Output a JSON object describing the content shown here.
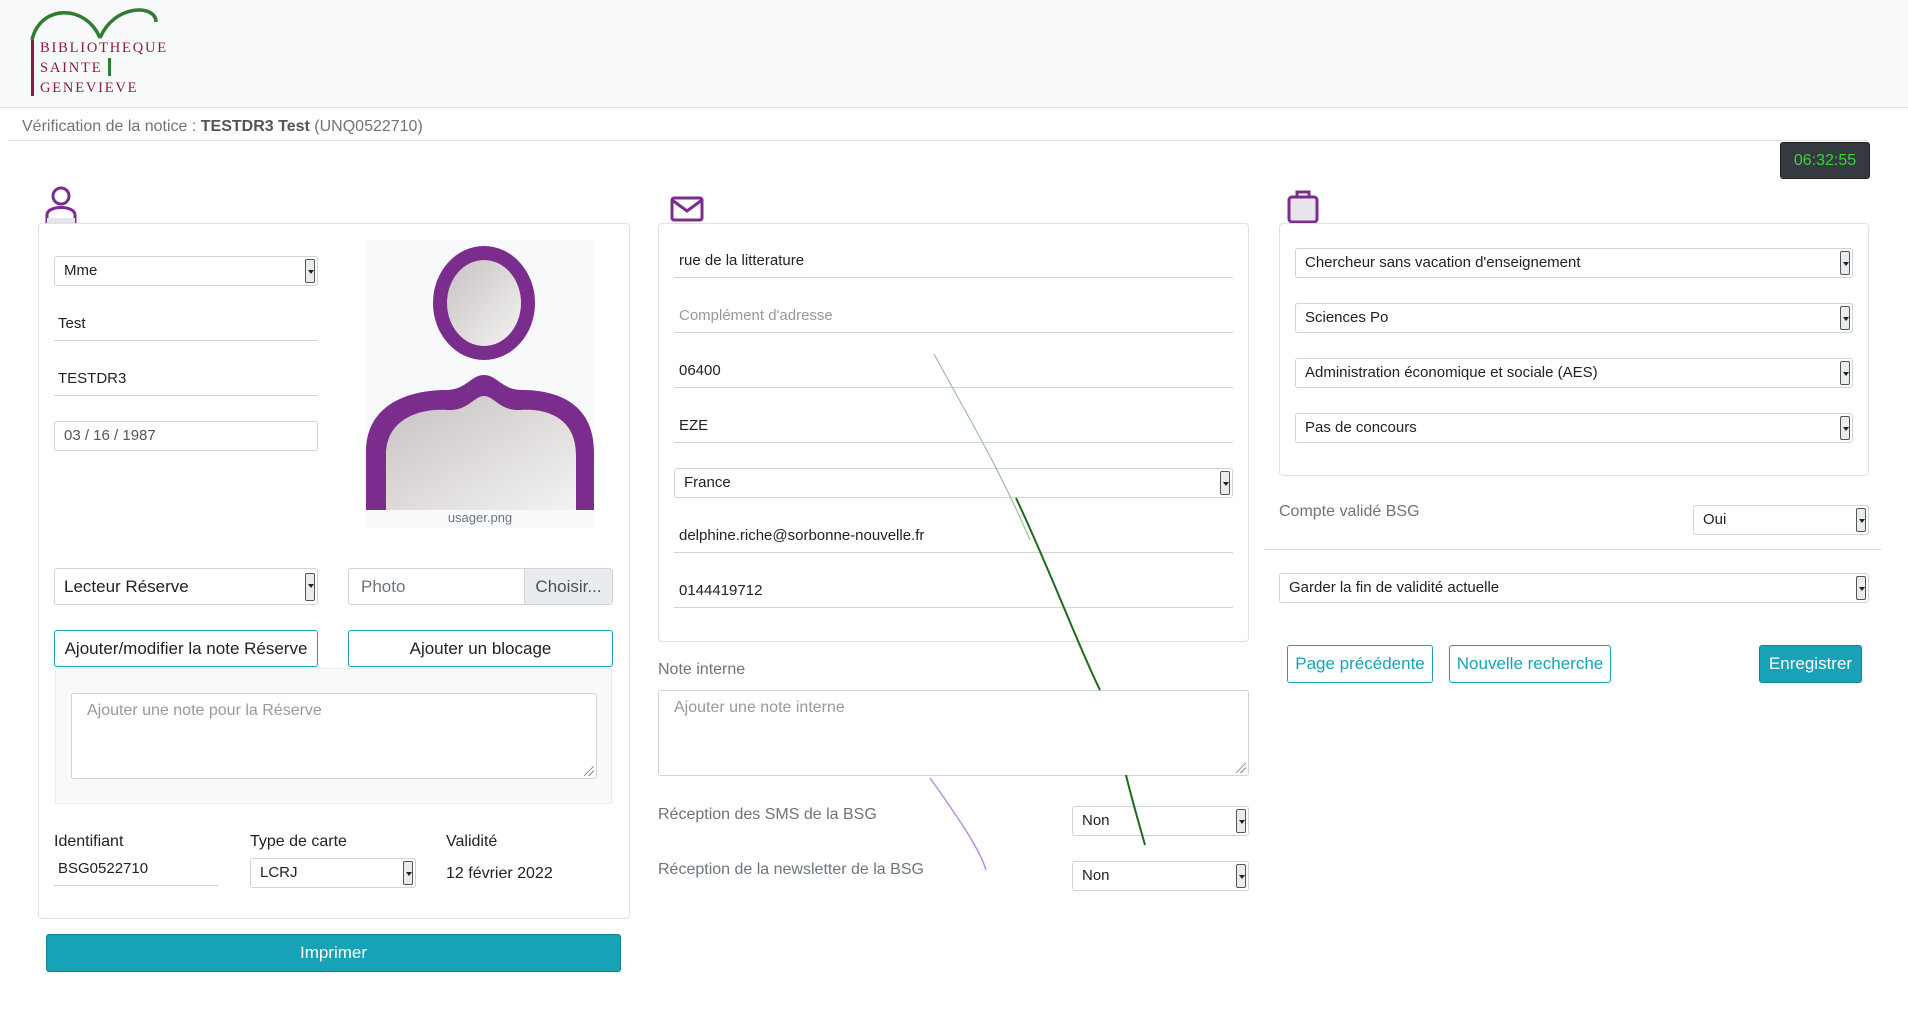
{
  "header": {
    "logo_text": [
      "BIBLIOTHEQUE",
      "SAINTE",
      "GENEVIEVE"
    ]
  },
  "notice": {
    "prefix": "Vérification de la notice : ",
    "name": "TESTDR3 Test",
    "id": "(UNQ0522710)"
  },
  "timer": "06:32:55",
  "personal": {
    "civility": "Mme",
    "first_name": "Test",
    "last_name": "TESTDR3",
    "birth_date": "03 / 16 / 1987",
    "photo_caption": "usager.png",
    "reader_type": "Lecteur Réserve",
    "photo_field_placeholder": "Photo",
    "photo_field_button": "Choisir...",
    "note_button": "Ajouter/modifier la note Réserve",
    "block_button": "Ajouter un blocage",
    "reserve_note_placeholder": "Ajouter une note pour la Réserve",
    "identifier_label": "Identifiant",
    "identifier_value": "BSG0522710",
    "card_type_label": "Type de carte",
    "card_type_value": "LCRJ",
    "validity_label": "Validité",
    "validity_value": "12 février 2022",
    "print_button": "Imprimer"
  },
  "contact": {
    "street": "rue de la litterature",
    "address_complement_placeholder": "Complément d'adresse",
    "postal_code": "06400",
    "city": "EZE",
    "country": "France",
    "email": "delphine.riche@sorbonne-nouvelle.fr",
    "phone": "0144419712",
    "internal_note_label": "Note interne",
    "internal_note_placeholder": "Ajouter une note interne",
    "sms_label": "Réception des SMS de la BSG",
    "sms_value": "Non",
    "newsletter_label": "Réception de la newsletter de la BSG",
    "newsletter_value": "Non"
  },
  "profession": {
    "category": "Chercheur sans vacation d'enseignement",
    "institution": "Sciences Po",
    "discipline": "Administration économique et sociale (AES)",
    "exam": "Pas de concours",
    "account_validated_label": "Compte validé BSG",
    "account_validated_value": "Oui",
    "validity_option": "Garder la fin de validité actuelle",
    "prev_button": "Page précédente",
    "new_search_button": "Nouvelle recherche",
    "save_button": "Enregistrer"
  },
  "colors": {
    "accent": "#17a2b8",
    "icon_purple": "#7b2d8e",
    "logo_red": "#8a1c3a",
    "logo_green": "#2e7d32",
    "timer_text": "#3ad43a"
  }
}
